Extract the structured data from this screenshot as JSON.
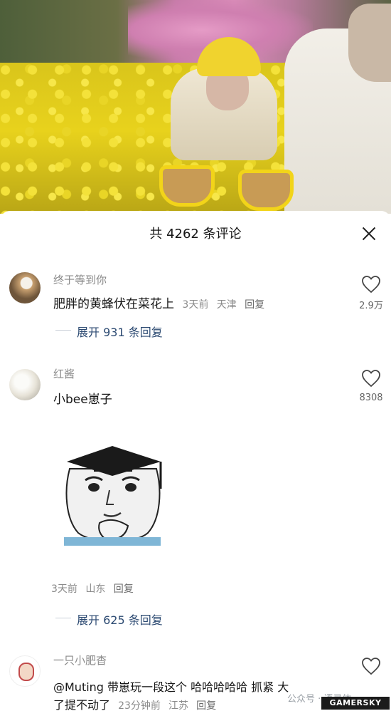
{
  "sheet": {
    "title": "共 4262 条评论"
  },
  "comments": [
    {
      "username": "终于等到你",
      "text": "肥胖的黄蜂伏在菜花上",
      "time": "3天前",
      "location": "天津",
      "reply_label": "回复",
      "likes": "2.9万",
      "expand_label": "展开 931 条回复"
    },
    {
      "username": "红酱",
      "text": "小bee崽子",
      "time": "3天前",
      "location": "山东",
      "reply_label": "回复",
      "likes": "8308",
      "expand_label": "展开 625 条回复"
    },
    {
      "username": "一只小肥杳",
      "text_line1": "@Muting  带崽玩一段这个 哈哈哈哈哈 抓紧 大",
      "text_line2": "了提不动了",
      "time": "23分钟前",
      "location": "江苏",
      "reply_label": "回复"
    }
  ],
  "watermark": {
    "text": "公众号 · 语录体",
    "badge": "GAMERSKY"
  },
  "icons": {
    "close": "close-icon",
    "like": "heart-outline-icon"
  }
}
